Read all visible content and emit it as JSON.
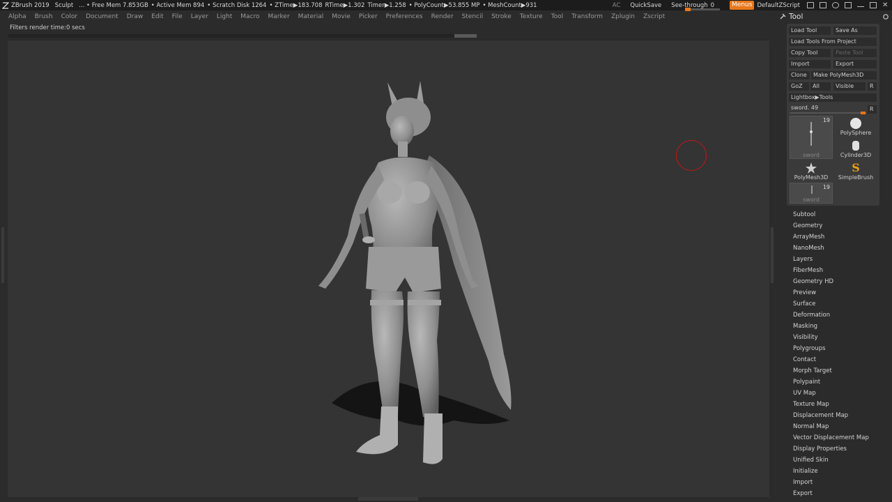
{
  "topbar": {
    "app_title": "ZBrush 2019",
    "document": "Sculpt",
    "free_mem": "... • Free Mem 7.853GB",
    "active_mem": "• Active Mem 894",
    "scratch_disk": "• Scratch Disk 1264",
    "ztime": "• ZTime▶183.708",
    "rtime": "RTime▶1.302",
    "timer": "Timer▶1.258",
    "polycount": "• PolyCount▶53.855 MP",
    "meshcount": "• MeshCount▶931",
    "ac": "AC",
    "quicksave": "QuickSave",
    "see_through_label": "See-through",
    "see_through_value": "0",
    "see_through_level": 0.0,
    "menus": "Menus",
    "script": "DefaultZScript",
    "accent_color": "#e8771a"
  },
  "menubar": [
    "Alpha",
    "Brush",
    "Color",
    "Document",
    "Draw",
    "Edit",
    "File",
    "Layer",
    "Light",
    "Macro",
    "Marker",
    "Material",
    "Movie",
    "Picker",
    "Preferences",
    "Render",
    "Stencil",
    "Stroke",
    "Texture",
    "Tool",
    "Transform",
    "Zplugin",
    "Zscript"
  ],
  "status": {
    "filters": "Filters render time:0 secs"
  },
  "tool_palette": {
    "title": "Tool",
    "load_tool": "Load Tool",
    "save_as": "Save As",
    "load_from_project": "Load Tools From Project",
    "copy_tool": "Copy Tool",
    "paste_tool": "Paste Tool",
    "import": "Import",
    "export": "Export",
    "clone": "Clone",
    "make_polymesh": "Make PolyMesh3D",
    "goz": "GoZ",
    "all": "All",
    "visible": "Visible",
    "r": "R",
    "lightbox_tools": "Lightbox▶Tools",
    "current_tool": "sword. 49",
    "r2": "R",
    "current_tool_level": 0.93,
    "thumb_count": "19",
    "thumb_name": "sword",
    "tiles": [
      "PolySphere",
      "Cylinder3D",
      "PolyMesh3D",
      "SimpleBrush"
    ],
    "thumb2_count": "19",
    "thumb2_name": "sword"
  },
  "subpalettes": [
    "Subtool",
    "Geometry",
    "ArrayMesh",
    "NanoMesh",
    "Layers",
    "FiberMesh",
    "Geometry HD",
    "Preview",
    "Surface",
    "Deformation",
    "Masking",
    "Visibility",
    "Polygroups",
    "Contact",
    "Morph Target",
    "Polypaint",
    "UV Map",
    "Texture Map",
    "Displacement Map",
    "Normal Map",
    "Vector Displacement Map",
    "Display Properties",
    "Unified Skin",
    "Initialize",
    "Import",
    "Export"
  ]
}
